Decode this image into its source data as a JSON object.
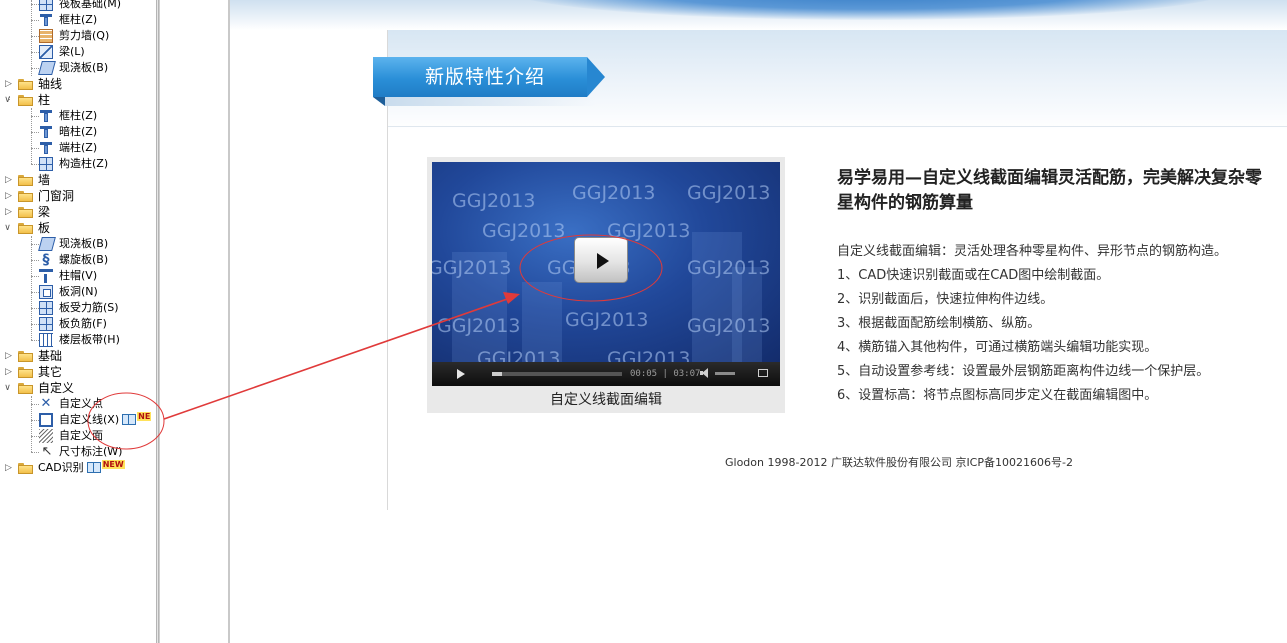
{
  "tree": {
    "items": [
      {
        "label": "筏板基础(M)",
        "icon": "raft-foundation-icon"
      },
      {
        "label": "框柱(Z)",
        "icon": "frame-column-icon"
      },
      {
        "label": "剪力墙(Q)",
        "icon": "shear-wall-icon"
      },
      {
        "label": "梁(L)",
        "icon": "beam-icon"
      },
      {
        "label": "现浇板(B)",
        "icon": "cast-slab-icon"
      },
      {
        "label": "轴线",
        "icon": "folder-icon"
      },
      {
        "label": "柱",
        "icon": "folder-icon"
      },
      {
        "label": "框柱(Z)",
        "icon": "frame-column-icon"
      },
      {
        "label": "暗柱(Z)",
        "icon": "hidden-column-icon"
      },
      {
        "label": "端柱(Z)",
        "icon": "end-column-icon"
      },
      {
        "label": "构造柱(Z)",
        "icon": "construction-column-icon"
      },
      {
        "label": "墙",
        "icon": "folder-icon"
      },
      {
        "label": "门窗洞",
        "icon": "folder-icon"
      },
      {
        "label": "梁",
        "icon": "folder-icon"
      },
      {
        "label": "板",
        "icon": "folder-icon"
      },
      {
        "label": "现浇板(B)",
        "icon": "cast-slab-icon"
      },
      {
        "label": "螺旋板(B)",
        "icon": "spiral-slab-icon"
      },
      {
        "label": "柱帽(V)",
        "icon": "column-cap-icon"
      },
      {
        "label": "板洞(N)",
        "icon": "slab-hole-icon"
      },
      {
        "label": "板受力筋(S)",
        "icon": "slab-rebar-icon"
      },
      {
        "label": "板负筋(F)",
        "icon": "slab-negative-rebar-icon"
      },
      {
        "label": "楼层板带(H)",
        "icon": "floor-band-icon"
      },
      {
        "label": "基础",
        "icon": "folder-icon"
      },
      {
        "label": "其它",
        "icon": "folder-icon"
      },
      {
        "label": "自定义",
        "icon": "folder-icon"
      },
      {
        "label": "自定义点",
        "icon": "custom-point-icon"
      },
      {
        "label": "自定义线(X)",
        "icon": "custom-line-icon",
        "badge": "NE"
      },
      {
        "label": "自定义面",
        "icon": "custom-face-icon"
      },
      {
        "label": "尺寸标注(W)",
        "icon": "dimension-icon"
      },
      {
        "label": "CAD识别",
        "icon": "folder-icon",
        "badge": "NEW"
      }
    ]
  },
  "main": {
    "banner_title": "新版特性介绍",
    "video": {
      "watermark": "GGJ2013",
      "time": "00:05 | 03:07",
      "caption": "自定义线截面编辑"
    },
    "headline": "易学易用—自定义线截面编辑灵活配筋，完美解决复杂零星构件的钢筋算量",
    "desc": [
      "自定义线截面编辑：灵活处理各种零星构件、异形节点的钢筋构造。",
      "1、CAD快速识别截面或在CAD图中绘制截面。",
      "2、识别截面后，快速拉伸构件边线。",
      "3、根据截面配筋绘制横筋、纵筋。",
      "4、横筋锚入其他构件，可通过横筋端头编辑功能实现。",
      "5、自动设置参考线：设置最外层钢筋距离构件边线一个保护层。",
      "6、设置标高：将节点图标高同步定义在截面编辑图中。"
    ],
    "footer": "Glodon 1998-2012 广联达软件股份有限公司 京ICP备10021606号-2"
  },
  "colors": {
    "banner": "#2a8fd8",
    "annotation": "#e03a3a",
    "tree_icon": "#2d5ea8"
  }
}
